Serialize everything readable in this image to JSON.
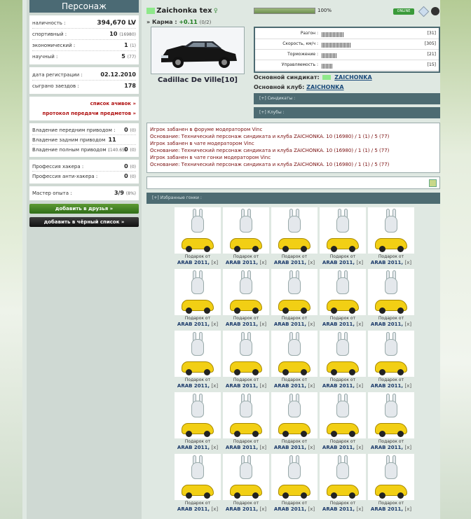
{
  "sidebar": {
    "title": "Персонаж",
    "stats": [
      {
        "label": "наличность :",
        "value": "394,670 LV",
        "sub": ""
      },
      {
        "label": "спортивный :",
        "value": "10",
        "sub": "(16980)"
      },
      {
        "label": "экономический :",
        "value": "1",
        "sub": "(1)"
      },
      {
        "label": "научный :",
        "value": "5",
        "sub": "(77)"
      }
    ],
    "reg_label": "дата регистрации :",
    "reg_value": "02.12.2010",
    "races_label": "сыграно заездов :",
    "races_value": "178",
    "links": [
      "список ачивок »",
      "протокол передачи предметов »"
    ],
    "ownership": [
      {
        "label": "Владение передним приводом :",
        "value": "0",
        "sub": "(0)"
      },
      {
        "label": "Владение задним приводом :",
        "value": "11",
        "sub": "(140.65)"
      },
      {
        "label": "Владение полным приводом :",
        "value": "0",
        "sub": "(0)"
      }
    ],
    "profs": [
      {
        "label": "Профессия хакера :",
        "value": "0",
        "sub": "(0)"
      },
      {
        "label": "Профессия анти-хакера :",
        "value": "0",
        "sub": "(0)"
      }
    ],
    "master_label": "Мастер опыта :",
    "master_value": "3/9",
    "master_sub": "(8%)",
    "friends_button": "добавить в друзья »",
    "blacklist_button": "добавить в чёрный список »"
  },
  "profile": {
    "nickname": "Zaichonka tex",
    "karma_label": "» Карма :",
    "karma_value": "+0.11",
    "karma_sub": "(0/2)",
    "car_name": "Cadillac De Ville[10]",
    "level_pct_text": "100%",
    "level_pct": 1.0,
    "online_label": "ONLINE",
    "status_color": "#8ee88a"
  },
  "skills": [
    {
      "label": "Разгон :",
      "value": "[31]",
      "level": 0.31
    },
    {
      "label": "Скорость, км/ч :",
      "value": "[305]",
      "level": 0.42
    },
    {
      "label": "Торможение :",
      "value": "[21]",
      "level": 0.21
    },
    {
      "label": "Управляемость :",
      "value": "[15]",
      "level": 0.15
    }
  ],
  "syndicate": {
    "label": "Основной синдикат:",
    "name": "ZAICHONKA"
  },
  "club": {
    "label": "Основной клуб:",
    "name": "ZAICHONKA"
  },
  "folds": [
    "[+] Синдикаты :",
    "[+] Клубы :"
  ],
  "bans": [
    "Игрок забанен в форуме модератором Vinc",
    "Основание: Технический персонаж синдиката и клуба ZAICHONKA. 10 (16980) / 1 (1) / 5 (77)",
    "Игрок забанен в чате модератором Vinc",
    "Основание: Технический персонаж синдиката и клуба ZAICHONKA. 10 (16980) / 1 (1) / 5 (77)",
    "Игрок забанен в чате гонки модератором Vinc",
    "Основание: Технический персонаж синдиката и клуба ZAICHONKA. 10 (16980) / 1 (1) / 5 (77)"
  ],
  "gifts_header": "[+] Избранные гонки :",
  "gift": {
    "line1": "Подарок от",
    "line2": "ARAB 2011,",
    "x": "[x]"
  }
}
